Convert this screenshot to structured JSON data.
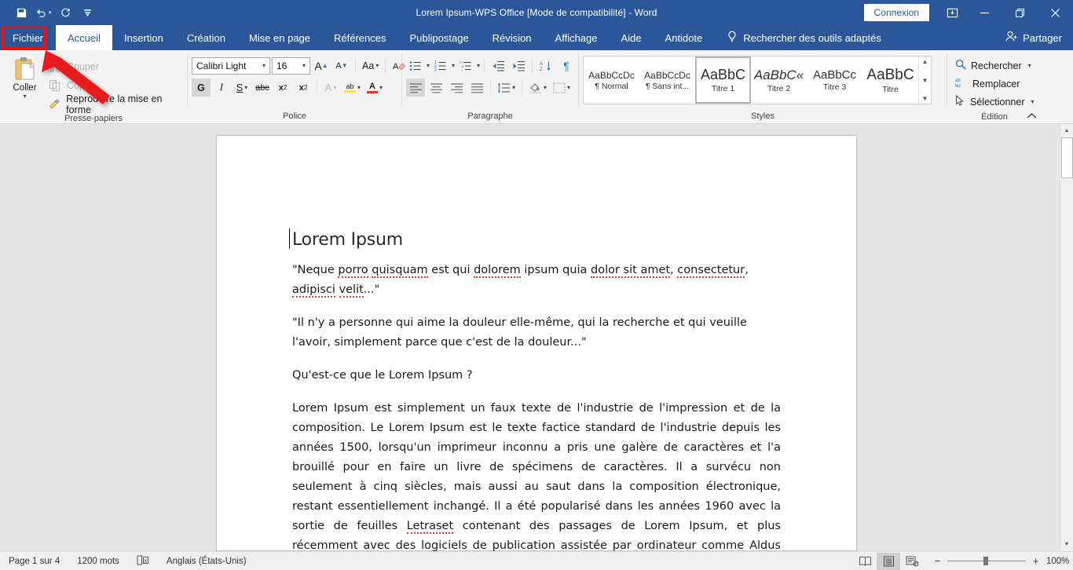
{
  "titlebar": {
    "document_title": "Lorem Ipsum-WPS Office [Mode de compatibilité]  -  Word",
    "signin_label": "Connexion",
    "quick_access": [
      {
        "name": "save-icon",
        "label": "Enregistrer"
      },
      {
        "name": "undo-icon",
        "label": "Annuler"
      },
      {
        "name": "redo-icon",
        "label": "Rétablir"
      },
      {
        "name": "customize-qat-icon",
        "label": "Personnaliser la barre d'outils Accès rapide"
      }
    ],
    "window_controls": {
      "ribbon_display": "Options d'affichage du Ruban",
      "minimize": "—",
      "restore": "❐",
      "close": "✕"
    }
  },
  "tabs": [
    {
      "label": "Fichier",
      "active": false,
      "highlighted": true
    },
    {
      "label": "Accueil",
      "active": true,
      "highlighted": false
    },
    {
      "label": "Insertion",
      "active": false,
      "highlighted": false
    },
    {
      "label": "Création",
      "active": false,
      "highlighted": false
    },
    {
      "label": "Mise en page",
      "active": false,
      "highlighted": false
    },
    {
      "label": "Références",
      "active": false,
      "highlighted": false
    },
    {
      "label": "Publipostage",
      "active": false,
      "highlighted": false
    },
    {
      "label": "Révision",
      "active": false,
      "highlighted": false
    },
    {
      "label": "Affichage",
      "active": false,
      "highlighted": false
    },
    {
      "label": "Aide",
      "active": false,
      "highlighted": false
    },
    {
      "label": "Antidote",
      "active": false,
      "highlighted": false
    }
  ],
  "tell_me": {
    "icon": "lightbulb-icon",
    "label": "Rechercher des outils adaptés"
  },
  "share": {
    "icon": "share-person-icon",
    "label": "Partager"
  },
  "ribbon": {
    "clipboard": {
      "group_label": "Presse-papiers",
      "paste_label": "Coller",
      "items": [
        {
          "label": "Couper",
          "icon": "scissors-icon",
          "disabled": true
        },
        {
          "label": "Copier",
          "icon": "copy-icon",
          "disabled": true
        },
        {
          "label": "Reproduire la mise en forme",
          "icon": "format-painter-icon",
          "disabled": false
        }
      ]
    },
    "font": {
      "group_label": "Police",
      "font_name": "Calibri Light",
      "font_size": "16",
      "buttons_row1": [
        {
          "label": "A",
          "name": "increase-font-size-button"
        },
        {
          "label": "A",
          "name": "decrease-font-size-button"
        },
        {
          "label": "Aa",
          "name": "change-case-button"
        },
        {
          "label": "",
          "name": "clear-formatting-button"
        }
      ],
      "bold_label": "G",
      "italic_label": "I",
      "underline_label": "S",
      "strikethrough_label": "abc",
      "subscript_label": "x",
      "superscript_label": "x",
      "text_effects_label": "A",
      "highlight_label": "ab",
      "font_color_label": "A"
    },
    "paragraph": {
      "group_label": "Paragraphe"
    },
    "styles": {
      "group_label": "Styles",
      "items": [
        {
          "preview": "AaBbCcDc",
          "name": "¶ Normal",
          "selected": false
        },
        {
          "preview": "AaBbCcDc",
          "name": "¶ Sans int...",
          "selected": false
        },
        {
          "preview": "AaBbC",
          "name": "Titre 1",
          "selected": true
        },
        {
          "preview": "AaBbC«",
          "name": "Titre 2",
          "selected": false
        },
        {
          "preview": "AaBbCc",
          "name": "Titre 3",
          "selected": false
        },
        {
          "preview": "AaBbC",
          "name": "Titre",
          "selected": false
        }
      ]
    },
    "editing": {
      "group_label": "Édition",
      "items": [
        {
          "label": "Rechercher",
          "icon": "search-icon",
          "caret": true
        },
        {
          "label": "Remplacer",
          "icon": "replace-icon",
          "caret": false
        },
        {
          "label": "Sélectionner",
          "icon": "select-pointer-icon",
          "caret": true
        }
      ]
    }
  },
  "document": {
    "heading": "Lorem Ipsum",
    "paragraphs": [
      "\"Neque porro quisquam est qui dolorem ipsum quia dolor sit amet, consectetur, adipisci velit...\"",
      "\"Il n'y a personne qui aime la douleur elle-même, qui la recherche et qui veuille l'avoir, simplement parce que c'est de la douleur...\"",
      "Qu'est-ce que le Lorem Ipsum ?",
      "Lorem Ipsum est simplement un faux texte de l'industrie de l'impression et de la composition. Le Lorem Ipsum est le texte factice standard de l'industrie depuis les années 1500, lorsqu'un imprimeur inconnu a pris une galère de caractères et l'a brouillé pour en faire un livre de spécimens de caractères. Il a survécu non seulement à cinq siècles, mais aussi au saut dans la composition électronique, restant essentiellement inchangé. Il a été popularisé dans les années 1960 avec la sortie de feuilles Letraset contenant des passages de Lorem Ipsum, et plus récemment avec des logiciels de publication assistée par ordinateur comme Aldus PageMaker comprenant des versions de Lorem Ipsum."
    ]
  },
  "statusbar": {
    "page_info": "Page 1 sur 4",
    "word_count": "1200 mots",
    "proofing_icon": "proofing-errors-icon",
    "language": "Anglais (États-Unis)",
    "views": [
      {
        "name": "read-mode-view-button",
        "selected": false
      },
      {
        "name": "print-layout-view-button",
        "selected": true
      },
      {
        "name": "web-layout-view-button",
        "selected": false
      }
    ],
    "zoom_out": "−",
    "zoom_in": "+",
    "zoom_level": "100%"
  },
  "annotation": {
    "highlight_color": "#ee1111",
    "arrow_color": "#e81c1c",
    "target": "Fichier"
  }
}
